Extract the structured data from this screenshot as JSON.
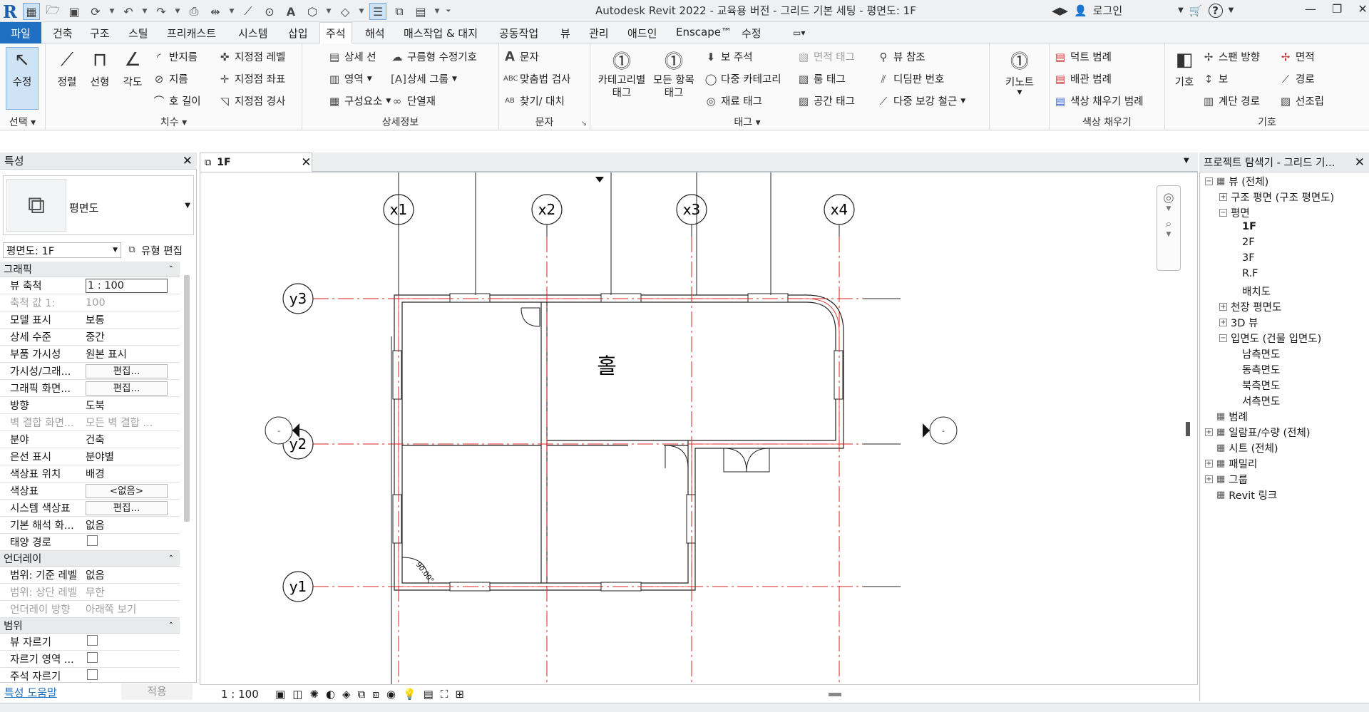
{
  "titlebar": {
    "logo": "R",
    "title": "Autodesk Revit 2022 - 교육용 버전 - 그리드 기본 세팅 - 평면도: 1F",
    "login": "로그인",
    "help": "?",
    "qat_icons": [
      "modify-mode-icon",
      "open-icon",
      "save-icon",
      "sync-icon",
      "undo-icon",
      "redo-icon",
      "print-icon",
      "measure-icon",
      "dimension-icon",
      "tag-icon",
      "text-icon",
      "3d-view-icon",
      "section-icon",
      "thin-lines-icon",
      "close-hidden-icon",
      "switch-windows-icon",
      "customize-icon"
    ]
  },
  "menu": {
    "file": "파일",
    "tabs": [
      "건축",
      "구조",
      "스틸",
      "프리캐스트",
      "시스템",
      "삽입",
      "주석",
      "해석",
      "매스작업 & 대지",
      "공동작업",
      "뷰",
      "관리",
      "애드인",
      "Enscape™",
      "수정"
    ],
    "active": "주석"
  },
  "ribbon": {
    "select": {
      "modify": "수정",
      "label": "선택"
    },
    "dimension": {
      "label": "치수",
      "aligned": "정렬",
      "linear": "선형",
      "angular": "각도",
      "radius": "반지름",
      "diameter": "지름",
      "arc_length": "호 길이",
      "spot_elevation": "지정점 레벨",
      "spot_coordinate": "지정점 좌표",
      "spot_slope": "지정점 경사"
    },
    "detail": {
      "label": "상세정보",
      "detail_line": "상세 선",
      "region": "영역",
      "component": "구성요소",
      "revision_cloud": "구름형 수정기호",
      "detail_group": "상세 그룹",
      "insulation": "단열재"
    },
    "text": {
      "label": "문자",
      "text": "문자",
      "spelling": "맞춤법 검사",
      "find_replace": "찾기/ 대치"
    },
    "tag": {
      "label": "태그",
      "by_category": "카테고리별 태그",
      "all": "모든 항목 태그",
      "beam_annotation": "보 주석",
      "multi_category": "다중 카테고리",
      "material_tag": "재료 태그",
      "area_tag": "면적 태그",
      "room_tag": "룸 태그",
      "space_tag": "공간 태그",
      "view_reference": "뷰 참조",
      "tread_number": "디딤판 번호",
      "multi_rebar": "다중 보강 철근",
      "keynote": "키노트"
    },
    "color_fill": {
      "label": "색상 채우기",
      "duct_legend": "덕트 범례",
      "pipe_legend": "배관 범례",
      "color_fill_legend": "색상 채우기 범례"
    },
    "symbol": {
      "label": "기호",
      "symbol": "기호",
      "span_direction": "스팬 방향",
      "beam": "보",
      "stair_path": "계단 경로",
      "area": "면적",
      "path": "경로",
      "fabric": "선조립"
    }
  },
  "properties": {
    "title": "특성",
    "type_name": "평면도",
    "view_selector": "평면도: 1F",
    "edit_type": "유형 편집",
    "sections": [
      {
        "name": "그래픽",
        "rows": [
          {
            "k": "뷰 축척",
            "v": "1 : 100",
            "kind": "input"
          },
          {
            "k": "축척 값    1:",
            "v": "100",
            "kind": "dim"
          },
          {
            "k": "모델 표시",
            "v": "보통"
          },
          {
            "k": "상세 수준",
            "v": "중간"
          },
          {
            "k": "부품 가시성",
            "v": "원본 표시"
          },
          {
            "k": "가시성/그래...",
            "v": "편집...",
            "kind": "button"
          },
          {
            "k": "그래픽 화면...",
            "v": "편집...",
            "kind": "button"
          },
          {
            "k": "방향",
            "v": "도북"
          },
          {
            "k": "벽 결합 화면...",
            "v": "모든 벽 결합 ...",
            "kind": "dim"
          },
          {
            "k": "분야",
            "v": "건축"
          },
          {
            "k": "은선 표시",
            "v": "분야별"
          },
          {
            "k": "색상표 위치",
            "v": "배경"
          },
          {
            "k": "색상표",
            "v": "<없음>",
            "kind": "button"
          },
          {
            "k": "시스템 색상표",
            "v": "편집...",
            "kind": "button"
          },
          {
            "k": "기본 해석 화...",
            "v": "없음"
          },
          {
            "k": "태양 경로",
            "v": "",
            "kind": "check"
          }
        ]
      },
      {
        "name": "언더레이",
        "rows": [
          {
            "k": "범위: 기준 레벨",
            "v": "없음"
          },
          {
            "k": "범위: 상단 레벨",
            "v": "무한",
            "kind": "dim"
          },
          {
            "k": "언더레이 방향",
            "v": "아래쪽 보기",
            "kind": "dim"
          }
        ]
      },
      {
        "name": "범위",
        "rows": [
          {
            "k": "뷰 자르기",
            "v": "",
            "kind": "check"
          },
          {
            "k": "자르기 영역 ...",
            "v": "",
            "kind": "check"
          },
          {
            "k": "주석 자르기",
            "v": "",
            "kind": "check"
          }
        ]
      }
    ],
    "help": "특성 도움말",
    "apply": "적용"
  },
  "view": {
    "tab": "1F",
    "grid_x": [
      "x1",
      "x2",
      "x3",
      "x4"
    ],
    "grid_y": [
      "y3",
      "y2",
      "y1"
    ],
    "room": "홀",
    "angle": "90.00°",
    "scale": "1 : 100"
  },
  "browser": {
    "title": "프로젝트 탐색기 - 그리드 기...",
    "nodes": [
      {
        "t": "뷰 (전체)",
        "lvl": 0,
        "exp": "-"
      },
      {
        "t": "구조 평면 (구조 평면도)",
        "lvl": 1,
        "exp": "+"
      },
      {
        "t": "평면",
        "lvl": 1,
        "exp": "-"
      },
      {
        "t": "1F",
        "lvl": 2,
        "bold": true
      },
      {
        "t": "2F",
        "lvl": 2
      },
      {
        "t": "3F",
        "lvl": 2
      },
      {
        "t": "R.F",
        "lvl": 2
      },
      {
        "t": "배치도",
        "lvl": 2
      },
      {
        "t": "천장 평면도",
        "lvl": 1,
        "exp": "+"
      },
      {
        "t": "3D 뷰",
        "lvl": 1,
        "exp": "+"
      },
      {
        "t": "입면도 (건물 입면도)",
        "lvl": 1,
        "exp": "-"
      },
      {
        "t": "남측면도",
        "lvl": 2
      },
      {
        "t": "동측면도",
        "lvl": 2
      },
      {
        "t": "북측면도",
        "lvl": 2
      },
      {
        "t": "서측면도",
        "lvl": 2
      },
      {
        "t": "범례",
        "lvl": 0
      },
      {
        "t": "일람표/수량 (전체)",
        "lvl": 0,
        "exp": "+"
      },
      {
        "t": "시트 (전체)",
        "lvl": 0
      },
      {
        "t": "패밀리",
        "lvl": 0,
        "exp": "+"
      },
      {
        "t": "그룹",
        "lvl": 0,
        "exp": "+"
      },
      {
        "t": "Revit 링크",
        "lvl": 0
      }
    ]
  }
}
